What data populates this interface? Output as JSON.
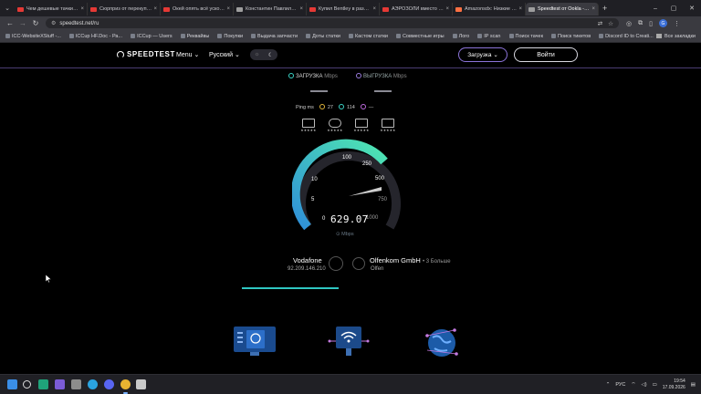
{
  "browser": {
    "tabs": [
      {
        "label": "Чем дешевые тачки - те...",
        "color": "#e53935"
      },
      {
        "label": "Сюрприз от перекупа! №...",
        "color": "#e53935"
      },
      {
        "label": "Окей опять всё ускоени...",
        "color": "#e53935"
      },
      {
        "label": "Константин Павлилито...",
        "color": "#9e9e9e"
      },
      {
        "label": "Купил Bentley в разводе...",
        "color": "#e53935"
      },
      {
        "label": "АЭРОЗОЛИ вместо бен...",
        "color": "#e53935"
      },
      {
        "label": "Amazonsdx: Низкие цен...",
        "color": "#ff7043"
      },
      {
        "label": "Speedtest от Ookla - Гло...",
        "color": "#9e9e9e",
        "active": true
      }
    ],
    "url": "speedtest.net/ru",
    "bookmarks": [
      "ICC-WebsiteXStuff -...",
      "ICCup HF.Doc - Ра...",
      "ICCup — Users",
      "Реквайвы",
      "Покупки",
      "Выдача запчасти",
      "Доты статки",
      "Кастом статки",
      "Совместные игры",
      "Лого",
      "IP scan",
      "Поиск тачек",
      "Поиск тикетов",
      "Discord ID to Creati..."
    ],
    "bookmarks_all": "Все закладки",
    "profile_initial": "G"
  },
  "header": {
    "logo": "SPEEDTEST",
    "menu": "Menu",
    "language": "Русский",
    "upload_button": "Загрузка",
    "login_button": "Войти"
  },
  "test": {
    "download_label": "ЗАГРУЗКА",
    "upload_label": "ВЫГРУЗКА",
    "unit": "Mbps",
    "ping_label": "Ping ms",
    "ping_idle": "27",
    "ping_download": "114",
    "ping_upload": "—",
    "usecase_stars": "★★★★★",
    "gauge_ticks": [
      "0",
      "5",
      "10",
      "100",
      "250",
      "500",
      "750",
      "1000"
    ],
    "gauge_value": "629.07",
    "gauge_unit": "Mbps",
    "gauge_max": 1000
  },
  "isp": {
    "name": "Vodafone",
    "ip": "92.209.146.210"
  },
  "server": {
    "name": "Olfenkom GmbH",
    "more": "• 3 Больше",
    "city": "Olfen"
  },
  "taskbar": {
    "language": "РУС",
    "time": "19:54",
    "date": "17.09.2026"
  },
  "colors": {
    "accent_cyan": "#2fc7c2",
    "accent_purple": "#8b73d8",
    "gauge_gradient_start": "#2f8fd9",
    "gauge_gradient_end": "#4fe8b0"
  }
}
